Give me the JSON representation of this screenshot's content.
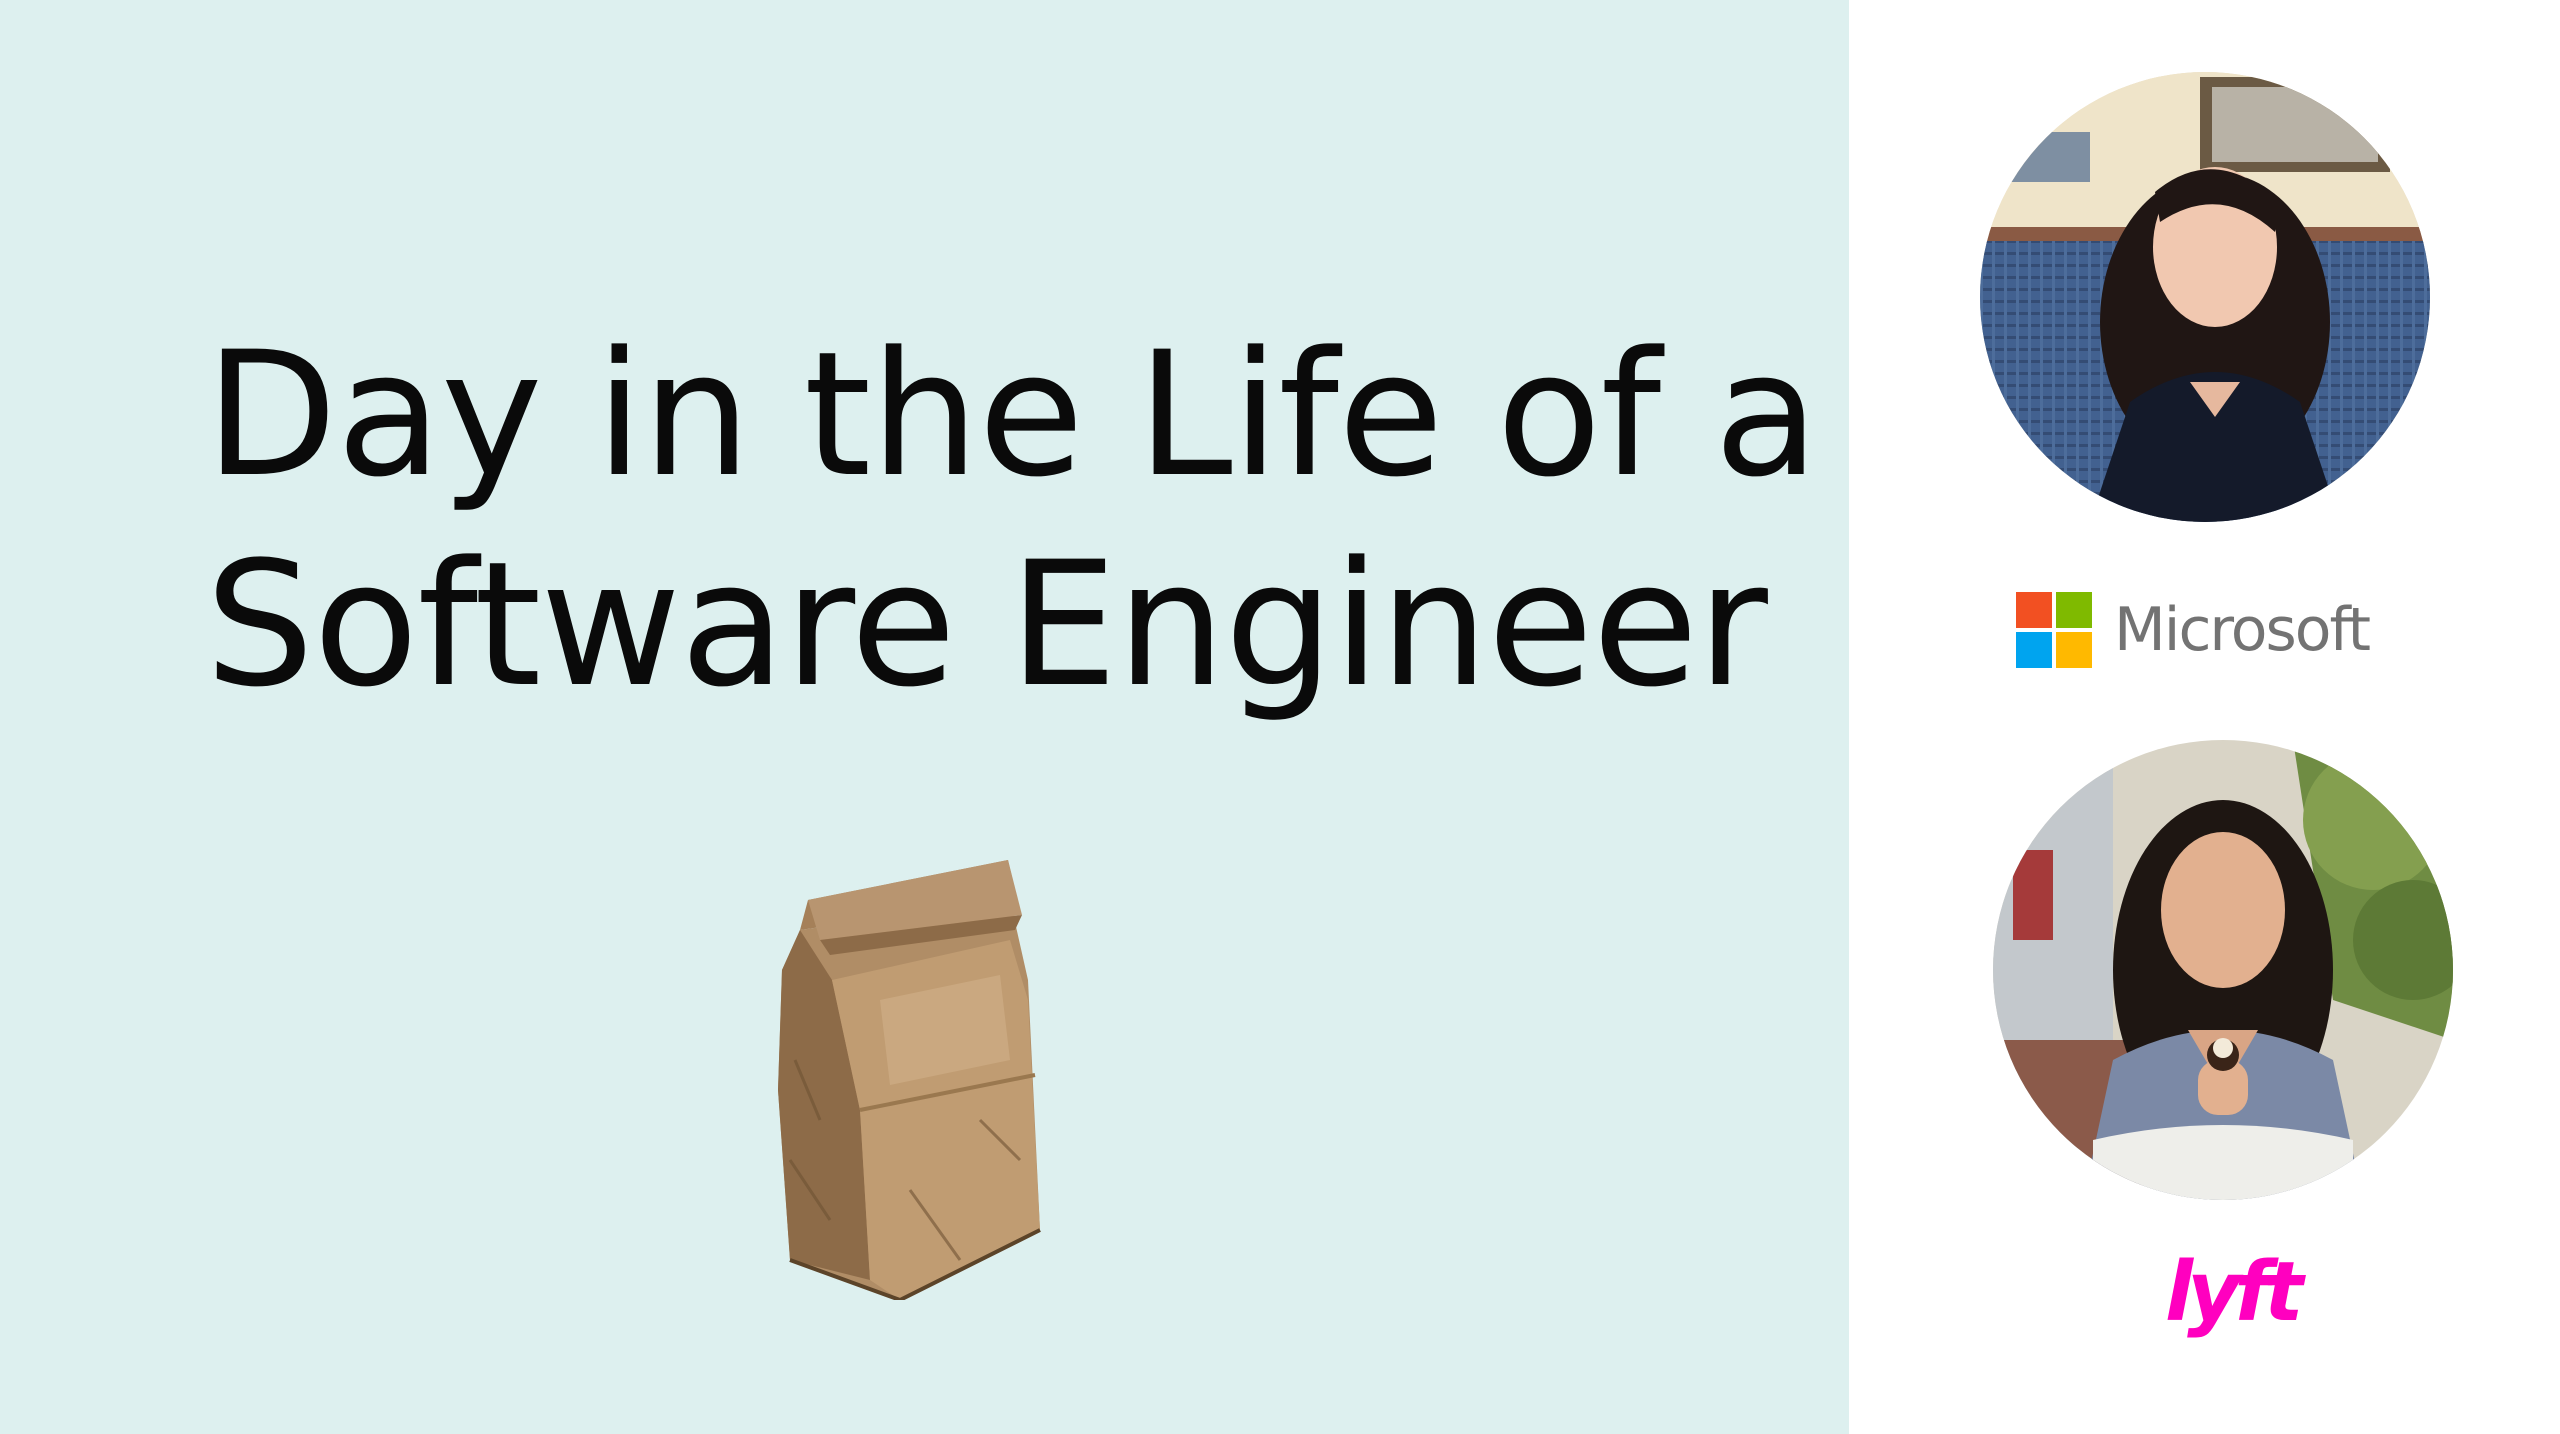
{
  "slide": {
    "title_line1": "Day in the Life of a",
    "title_line2": "Software Engineer",
    "background_color": "#ddf0ef"
  },
  "icons": {
    "bag": "paper-bag-icon"
  },
  "speakers": [
    {
      "company": "Microsoft",
      "logo": "microsoft-logo",
      "logo_colors": [
        "#f25022",
        "#7fba00",
        "#00a4ef",
        "#ffb900"
      ]
    },
    {
      "company": "lyft",
      "logo": "lyft-logo",
      "logo_color": "#ff00bf"
    }
  ]
}
